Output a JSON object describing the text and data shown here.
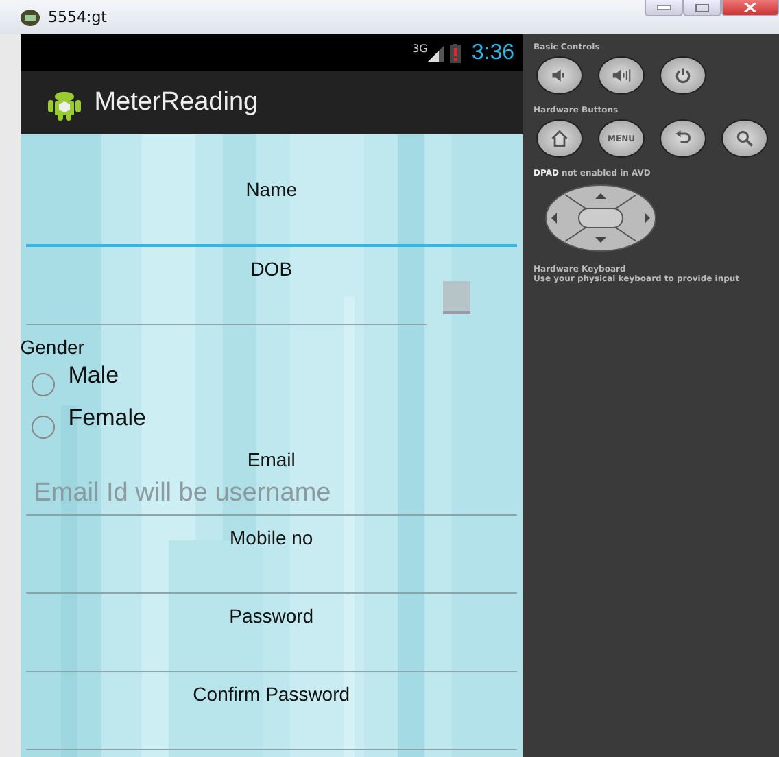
{
  "window": {
    "title": "5554:gt"
  },
  "status_bar": {
    "network": "3G",
    "battery_alert": true,
    "time": "3:36"
  },
  "app_bar": {
    "title": "MeterReading"
  },
  "form": [
    {
      "kind": "text",
      "label": "Name",
      "focused": true
    },
    {
      "kind": "date",
      "label": "DOB",
      "focused": false
    },
    {
      "kind": "radio",
      "label": "Gender",
      "options": [
        {
          "label": "Male",
          "selected": false
        },
        {
          "label": "Female",
          "selected": false
        }
      ]
    },
    {
      "kind": "text",
      "label": "Email",
      "placeholder": "Email Id will be username",
      "focused": false
    },
    {
      "kind": "text",
      "label": "Mobile no",
      "focused": false
    },
    {
      "kind": "text",
      "label": "Password",
      "focused": false
    },
    {
      "kind": "text",
      "label": "Confirm Password",
      "focused": false
    }
  ],
  "controls": {
    "sections": [
      {
        "kind": "buttons",
        "title": "Basic Controls",
        "buttons": [
          {
            "kind": "volume-down"
          },
          {
            "kind": "volume-up"
          },
          {
            "kind": "power"
          }
        ]
      },
      {
        "kind": "buttons",
        "title": "Hardware Buttons",
        "buttons": [
          {
            "kind": "home"
          },
          {
            "kind": "text",
            "label": "MENU"
          },
          {
            "kind": "back"
          },
          {
            "kind": "search"
          }
        ]
      },
      {
        "kind": "dpad",
        "title": "**DPAD** not enabled in AVD"
      },
      {
        "kind": "note",
        "title": "Hardware Keyboard",
        "text": "Use your physical keyboard to provide input"
      }
    ]
  }
}
